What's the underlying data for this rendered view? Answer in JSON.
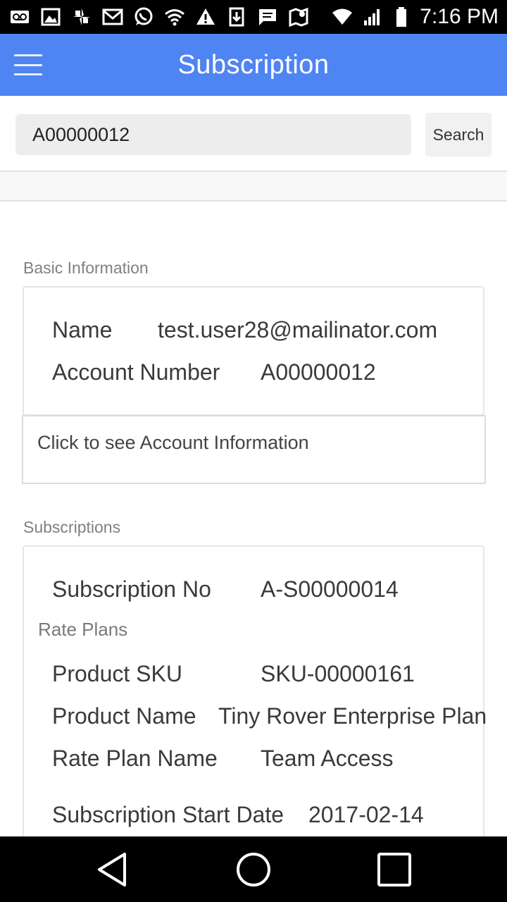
{
  "status_bar": {
    "time": "7:16 PM",
    "left_icons": [
      "voicemail-icon",
      "image-icon",
      "pinwheel-icon",
      "gmail-icon",
      "whatsapp-icon",
      "wifi-alert-icon",
      "warning-icon",
      "download-icon",
      "message-icon",
      "maps-icon"
    ],
    "right_icons": [
      "wifi-icon",
      "signal-icon",
      "battery-icon"
    ]
  },
  "app_bar": {
    "title": "Subscription"
  },
  "search": {
    "value": "A00000012",
    "button_label": "Search"
  },
  "basic_info": {
    "section_label": "Basic Information",
    "name_label": "Name",
    "name_value": "test.user28@mailinator.com",
    "account_label": "Account Number",
    "account_value": "A00000012",
    "account_link": "Click to see Account Information"
  },
  "subscriptions": {
    "section_label": "Subscriptions",
    "sub_no_label": "Subscription No",
    "sub_no_value": "A-S00000014",
    "rate_plans_label": "Rate Plans",
    "sku_label": "Product SKU",
    "sku_value": "SKU-00000161",
    "product_name_label": "Product Name",
    "product_name_value": "Tiny Rover Enterprise Plan",
    "rate_plan_label": "Rate Plan Name",
    "rate_plan_value": "Team Access",
    "start_date_label": "Subscription Start Date",
    "start_date_value": "2017-02-14"
  },
  "colors": {
    "app_bar": "#4f84f3",
    "status_bar": "#000000",
    "text": "#3a3a3a",
    "muted": "#808080"
  }
}
